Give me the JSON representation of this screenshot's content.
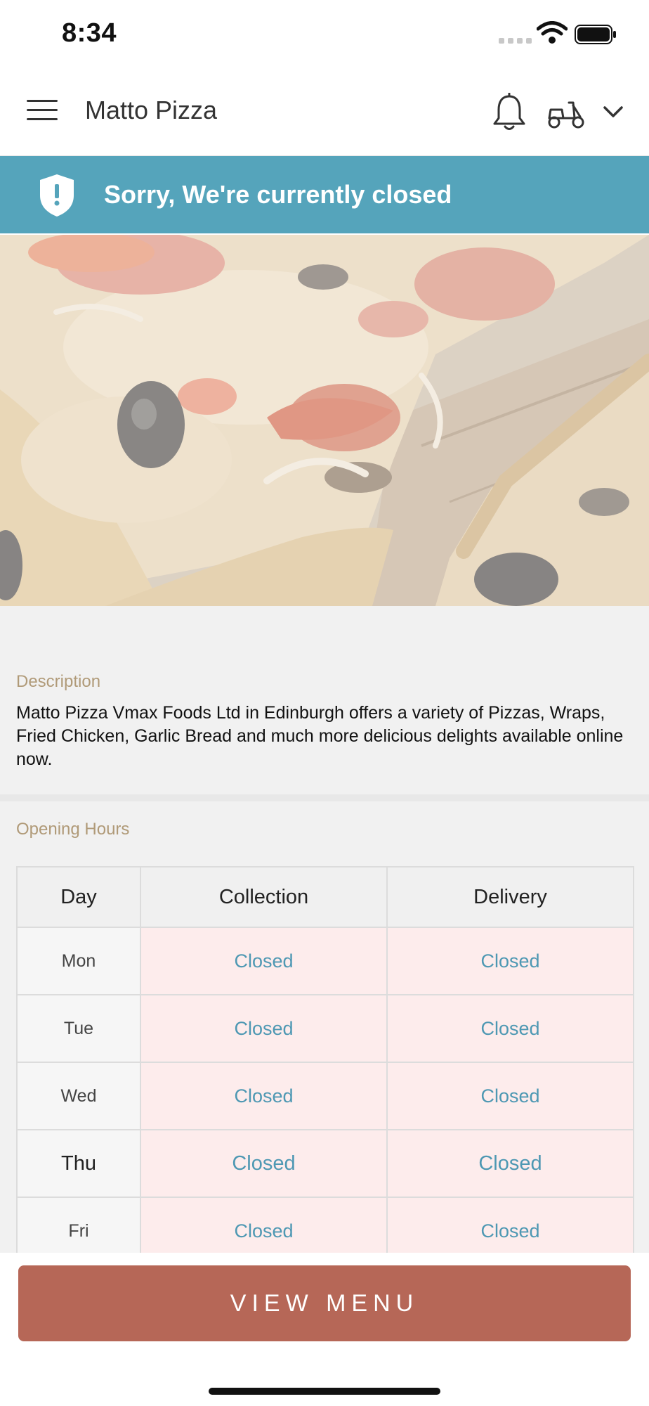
{
  "status_bar": {
    "time": "8:34"
  },
  "header": {
    "title": "Matto Pizza"
  },
  "banner": {
    "text": "Sorry, We're currently closed",
    "color": "#55a4bb"
  },
  "hero": {
    "image": "pizza-photo"
  },
  "description": {
    "label": "Description",
    "text": "Matto Pizza Vmax Foods Ltd in Edinburgh offers a variety of Pizzas, Wraps, Fried Chicken, Garlic Bread and much more delicious delights available online now."
  },
  "opening_hours": {
    "label": "Opening Hours",
    "columns": [
      "Day",
      "Collection",
      "Delivery"
    ],
    "rows": [
      {
        "day": "Mon",
        "collection": "Closed",
        "delivery": "Closed"
      },
      {
        "day": "Tue",
        "collection": "Closed",
        "delivery": "Closed"
      },
      {
        "day": "Wed",
        "collection": "Closed",
        "delivery": "Closed"
      },
      {
        "day": "Thu",
        "collection": "Closed",
        "delivery": "Closed"
      },
      {
        "day": "Fri",
        "collection": "Closed",
        "delivery": "Closed"
      }
    ]
  },
  "footer": {
    "button_label": "VIEW MENU",
    "button_color": "#b66757"
  },
  "icons": [
    "menu-icon",
    "bell-icon",
    "scooter-icon",
    "chevron-down-icon",
    "shield-alert-icon",
    "wifi-icon",
    "battery-icon"
  ]
}
